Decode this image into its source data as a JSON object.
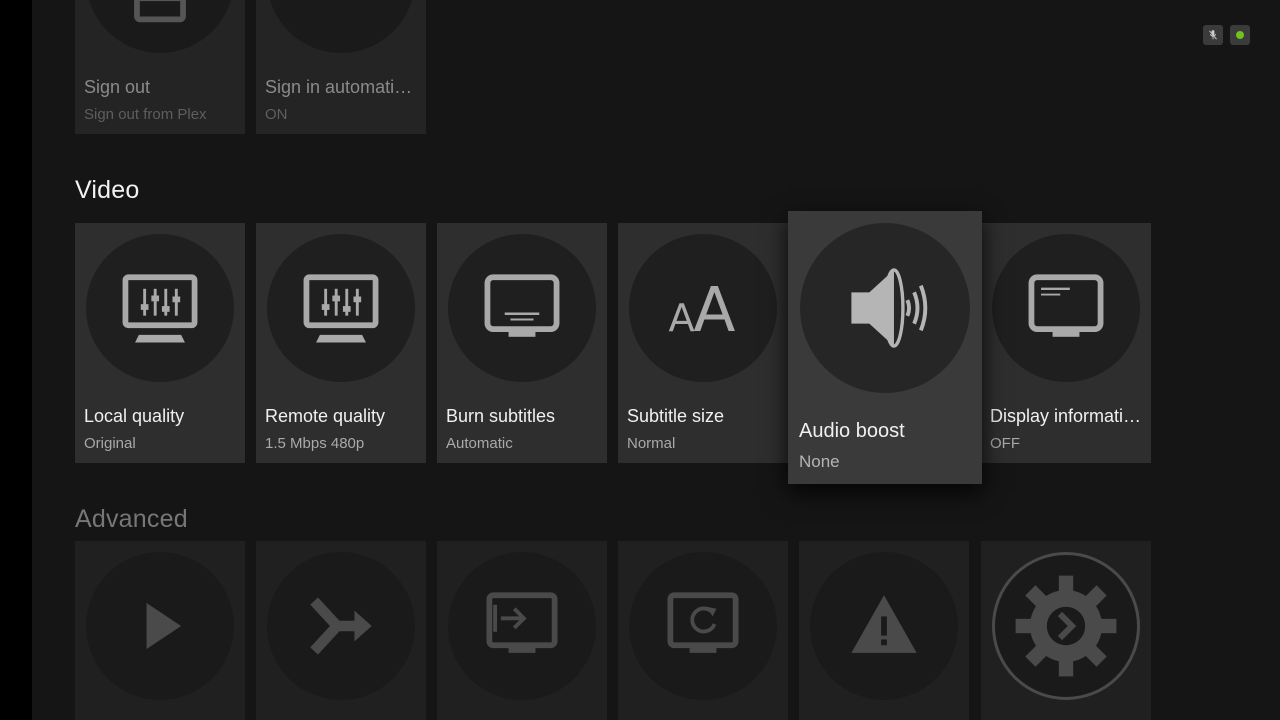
{
  "account_row": [
    {
      "label": "Sign out",
      "value": "Sign out from Plex"
    },
    {
      "label": "Sign in automatically",
      "value": "ON"
    }
  ],
  "video_section": {
    "title": "Video",
    "items": [
      {
        "label": "Local quality",
        "value": "Original",
        "icon": "monitor-sliders-icon"
      },
      {
        "label": "Remote quality",
        "value": "1.5 Mbps 480p",
        "icon": "monitor-sliders-icon"
      },
      {
        "label": "Burn subtitles",
        "value": "Automatic",
        "icon": "monitor-subtitles-icon"
      },
      {
        "label": "Subtitle size",
        "value": "Normal",
        "icon": "font-size-icon"
      },
      {
        "label": "Audio boost",
        "value": "None",
        "icon": "speaker-icon"
      },
      {
        "label": "Display informatio…",
        "value": "OFF",
        "icon": "monitor-info-icon"
      }
    ]
  },
  "advanced_section": {
    "title": "Advanced",
    "icons": [
      "play-icon",
      "merge-arrow-icon",
      "monitor-input-icon",
      "monitor-refresh-icon",
      "warning-icon",
      "plex-gear-icon"
    ]
  },
  "status_indicators": [
    {
      "name": "microphone-muted-icon"
    },
    {
      "name": "connection-status-icon",
      "color": "#6fc21c"
    }
  ],
  "colors": {
    "background": "#151515",
    "tile": "#2e2e2e",
    "tile_focused": "#3a3a3a",
    "icon": "#a9a9a9",
    "connection_ok": "#6fc21c"
  }
}
